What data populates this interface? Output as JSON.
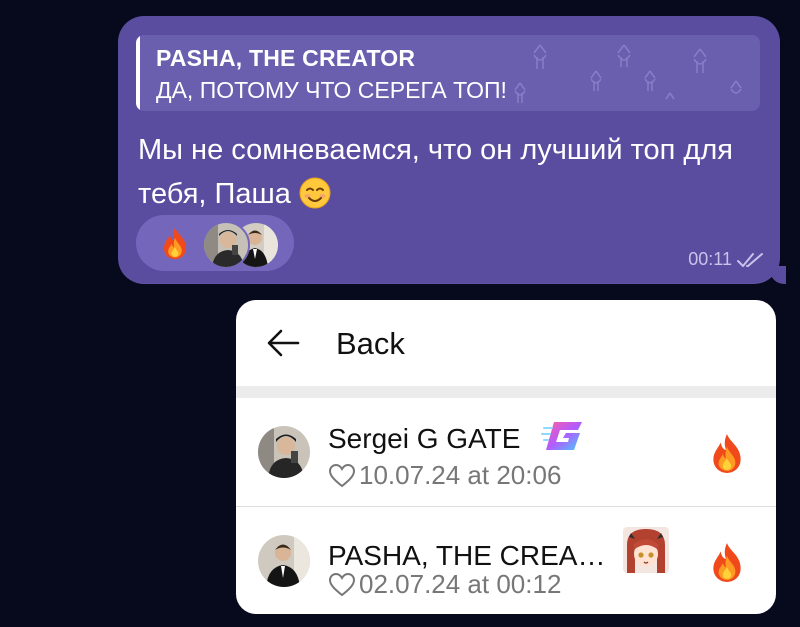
{
  "message": {
    "quote": {
      "author": "PASHA, THE CREATOR",
      "text": "ДА, ПОТОМУ ЧТО СЕРЕГА ТОП!"
    },
    "text": "Мы не сомневаемся, что он лучший топ для тебя, Паша",
    "emoji_icon": "smiling-face-icon",
    "reaction_icon": "fire-icon",
    "time": "00:11",
    "status_icon": "double-check-icon",
    "bubble_color": "#5a4da0"
  },
  "popup": {
    "back_label": "Back",
    "reactors": [
      {
        "name": "Sergei G GATE",
        "date": "10.07.24 at 20:06",
        "badge_icon": "gate-logo-icon",
        "reaction_icon": "fire-icon"
      },
      {
        "name": "PASHA, THE CREA…",
        "date": "02.07.24 at 00:12",
        "badge_icon": "anime-girl-icon",
        "reaction_icon": "fire-icon"
      }
    ]
  }
}
